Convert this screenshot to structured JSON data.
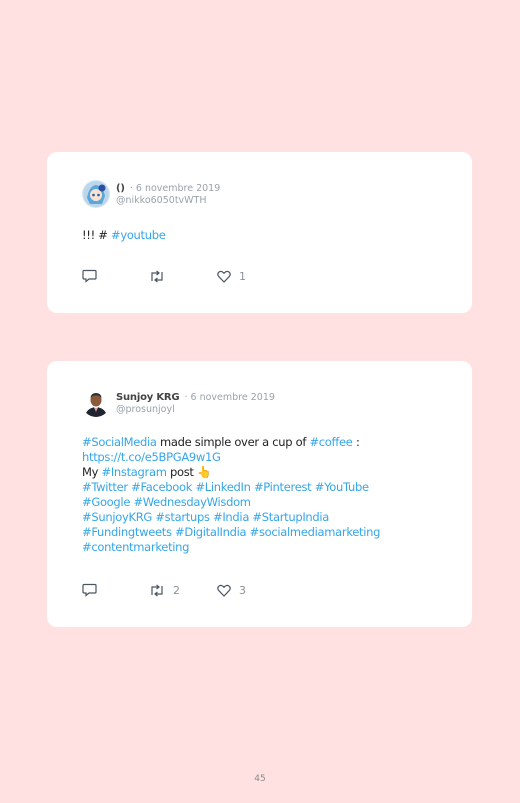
{
  "tweets": [
    {
      "display_name": "()",
      "date": "· 6 novembre 2019",
      "handle": "@nikko6050tvWTH",
      "text_segments": [
        {
          "text": "!!! # ",
          "type": "text"
        },
        {
          "text": "#youtube",
          "type": "tag"
        }
      ],
      "reply_count": "",
      "retweet_count": "",
      "like_count": "1"
    },
    {
      "display_name": "Sunjoy KRG",
      "date": "· 6 novembre 2019",
      "handle": "@prosunjoyl",
      "line1": {
        "tag1": "#SocialMedia",
        "text": " made simple over a cup of ",
        "tag2": "#coffee",
        "end": " :"
      },
      "line2": {
        "link": "https://t.co/e5BPGA9w1G"
      },
      "line3": {
        "text": "My ",
        "tag": "#Instagram",
        "text2": " post ",
        "emoji": "👆"
      },
      "hashtag_lines": [
        "#Twitter #Facebook #LinkedIn #Pinterest #YouTube",
        "#Google #WednesdayWisdom",
        "#SunjoyKRG #startups #India #StartupIndia",
        "#Fundingtweets #DigitalIndia #socialmediamarketing",
        "#contentmarketing"
      ],
      "reply_count": "",
      "retweet_count": "2",
      "like_count": "3"
    }
  ],
  "icons": {
    "reply": "reply-icon",
    "retweet": "retweet-icon",
    "like": "heart-icon"
  },
  "colors": {
    "background": "#ffe1e1",
    "card": "#ffffff",
    "link": "#35a6e8",
    "muted": "#9aa3aa"
  },
  "page_number": "45"
}
